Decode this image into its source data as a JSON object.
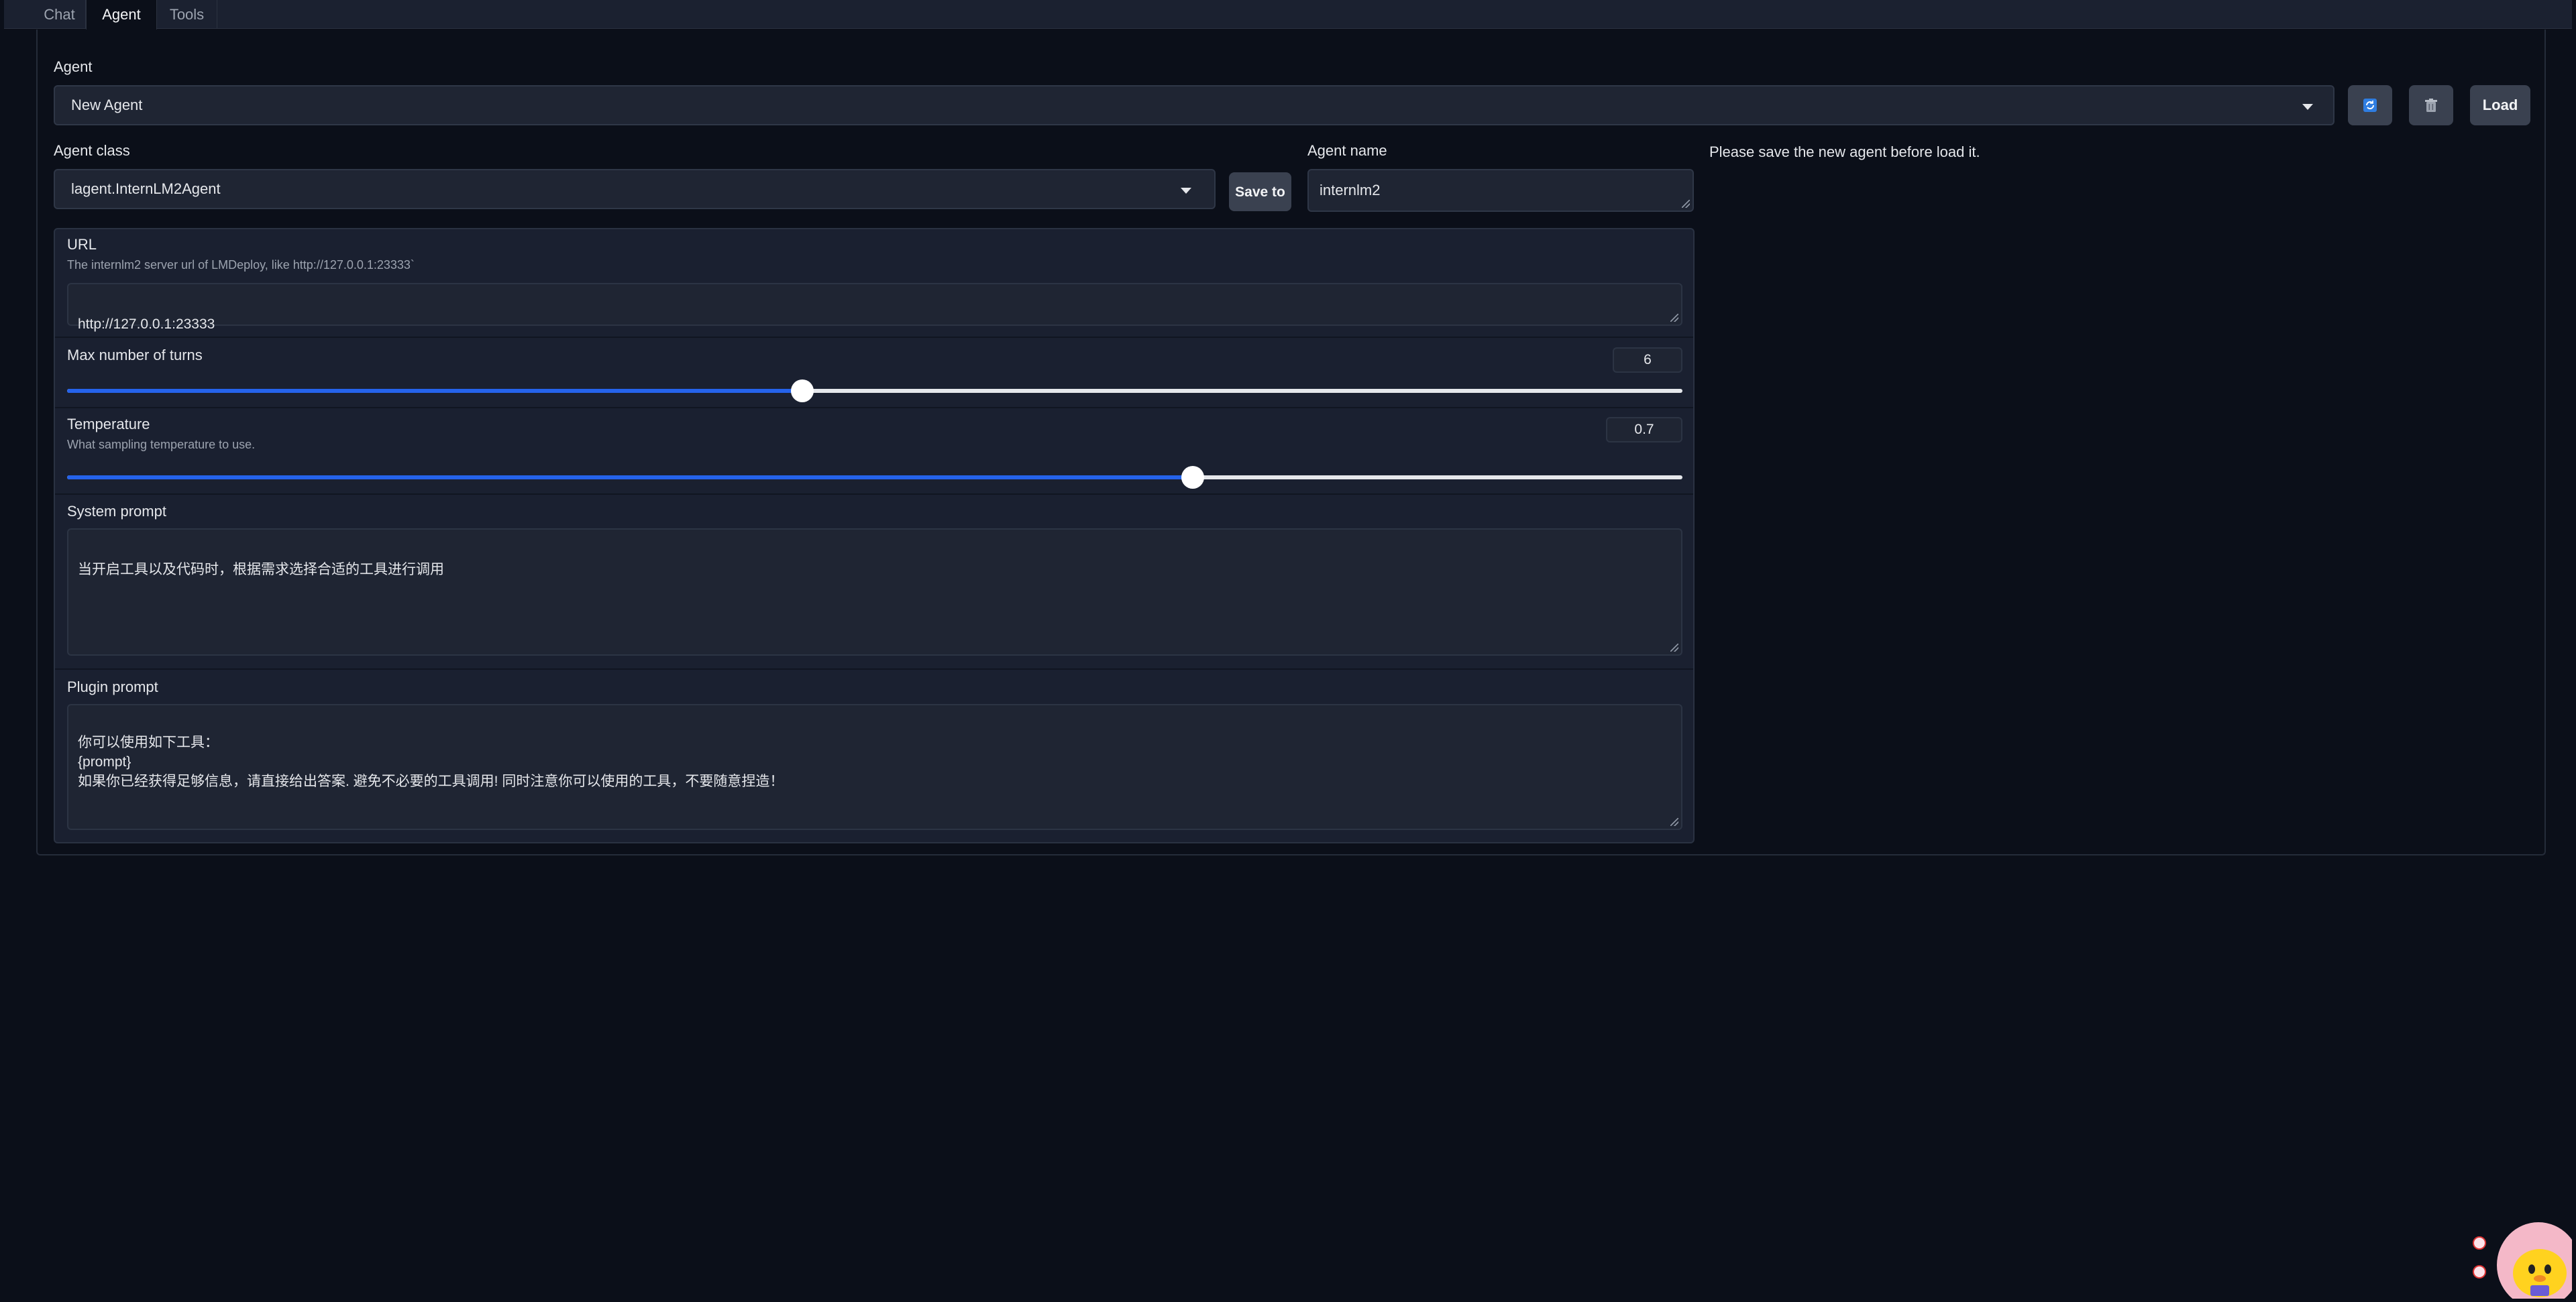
{
  "tabs": [
    {
      "label": "Chat",
      "active": false
    },
    {
      "label": "Agent",
      "active": true
    },
    {
      "label": "Tools",
      "active": false
    }
  ],
  "agent": {
    "label": "Agent",
    "selected": "New Agent",
    "refresh_icon": "refresh-icon",
    "delete_icon": "trash-icon",
    "load_label": "Load"
  },
  "agent_class": {
    "label": "Agent class",
    "selected": "lagent.InternLM2Agent",
    "save_label": "Save to"
  },
  "agent_name": {
    "label": "Agent name",
    "value": "internlm2"
  },
  "notice": "Please save the new agent before load it.",
  "url": {
    "label": "URL",
    "info": "The internlm2 server url of LMDeploy, like http://127.0.0.1:23333`",
    "value": "http://127.0.0.1:23333"
  },
  "max_turns": {
    "label": "Max number of turns",
    "value": "6",
    "fraction": 0.455
  },
  "temperature": {
    "label": "Temperature",
    "info": "What sampling temperature to use.",
    "value": "0.7",
    "fraction": 0.697
  },
  "system_prompt": {
    "label": "System prompt",
    "value": "当开启工具以及代码时，根据需求选择合适的工具进行调用"
  },
  "plugin_prompt": {
    "label": "Plugin prompt",
    "value": "你可以使用如下工具：\n{prompt}\n如果你已经获得足够信息，请直接给出答案. 避免不必要的工具调用! 同时注意你可以使用的工具，不要随意捏造！"
  },
  "colors": {
    "accent": "#2563eb",
    "background": "#0b0f19",
    "surface": "#1f2533"
  }
}
